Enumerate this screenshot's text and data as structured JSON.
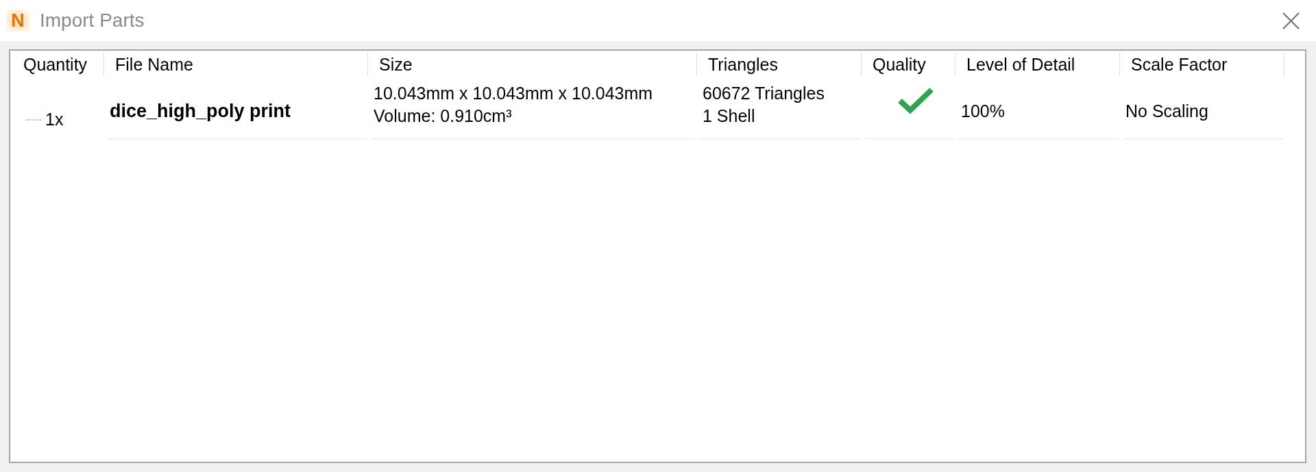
{
  "window": {
    "logo_text": "N",
    "title": "Import Parts"
  },
  "table": {
    "columns": [
      "Quantity",
      "File Name",
      "Size",
      "Triangles",
      "Quality",
      "Level of Detail",
      "Scale Factor"
    ],
    "rows": [
      {
        "quantity": "1x",
        "file_name": "dice_high_poly print",
        "size": [
          "10.043mm x 10.043mm x 10.043mm",
          "Volume: 0.910cm³"
        ],
        "triangles": [
          "60672 Triangles",
          "1 Shell"
        ],
        "quality_ok": true,
        "level_of_detail": "100%",
        "scale_factor": "No Scaling"
      }
    ]
  }
}
